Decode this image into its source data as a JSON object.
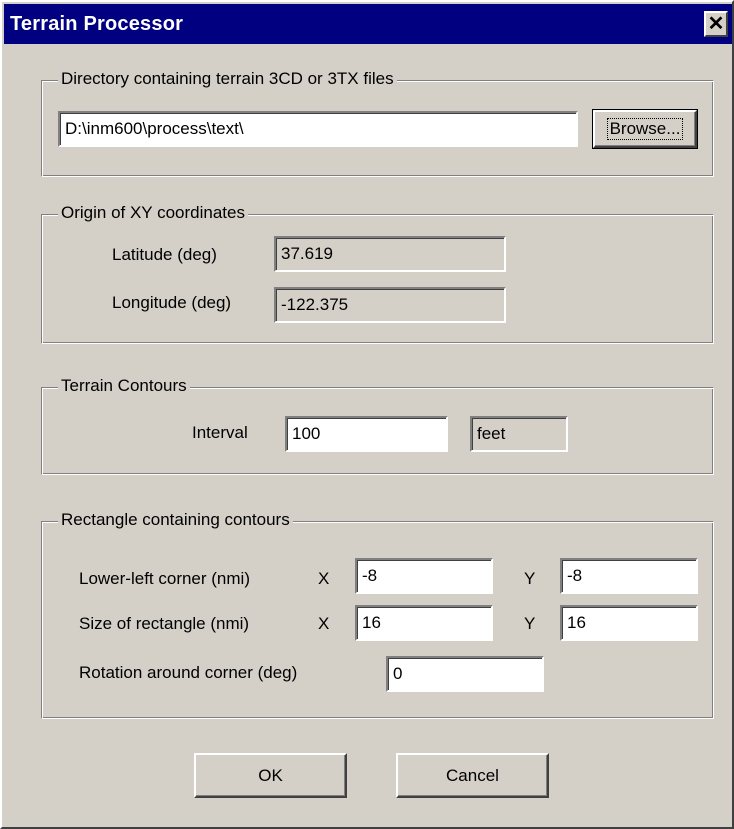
{
  "window": {
    "title": "Terrain Processor",
    "close_glyph": "✕"
  },
  "directory": {
    "legend": "Directory containing terrain 3CD or 3TX files",
    "path": "D:\\inm600\\process\\text\\",
    "browse_label": "Browse..."
  },
  "origin": {
    "legend": "Origin of XY coordinates",
    "latitude_label": "Latitude (deg)",
    "latitude_value": "37.619",
    "longitude_label": "Longitude (deg)",
    "longitude_value": "-122.375"
  },
  "contours": {
    "legend": "Terrain Contours",
    "interval_label": "Interval",
    "interval_value": "100",
    "unit": "feet"
  },
  "rectangle": {
    "legend": "Rectangle containing contours",
    "lower_left_label": "Lower-left corner (nmi)",
    "size_label": "Size of rectangle (nmi)",
    "x_label": "X",
    "y_label": "Y",
    "lower_left_x": "-8",
    "lower_left_y": "-8",
    "size_x": "16",
    "size_y": "16",
    "rotation_label": "Rotation around corner (deg)",
    "rotation_value": "0"
  },
  "actions": {
    "ok_label": "OK",
    "cancel_label": "Cancel"
  }
}
